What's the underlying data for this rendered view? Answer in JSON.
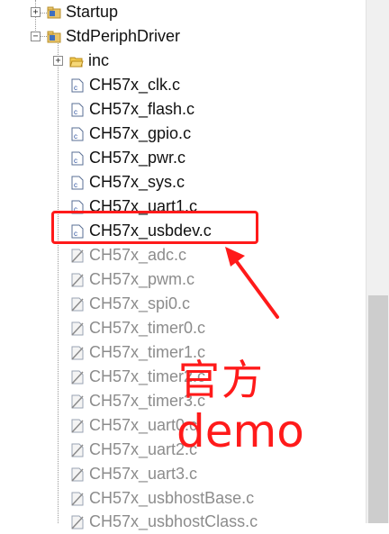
{
  "tree": {
    "folders": [
      {
        "label": "Startup",
        "expander": "+"
      },
      {
        "label": "StdPeriphDriver",
        "expander": "−"
      },
      {
        "label": "inc",
        "expander": "+"
      }
    ],
    "files": [
      {
        "label": "CH57x_clk.c",
        "excluded": false
      },
      {
        "label": "CH57x_flash.c",
        "excluded": false
      },
      {
        "label": "CH57x_gpio.c",
        "excluded": false
      },
      {
        "label": "CH57x_pwr.c",
        "excluded": false
      },
      {
        "label": "CH57x_sys.c",
        "excluded": false
      },
      {
        "label": "CH57x_uart1.c",
        "excluded": false
      },
      {
        "label": "CH57x_usbdev.c",
        "excluded": false
      },
      {
        "label": "CH57x_adc.c",
        "excluded": true
      },
      {
        "label": "CH57x_pwm.c",
        "excluded": true
      },
      {
        "label": "CH57x_spi0.c",
        "excluded": true
      },
      {
        "label": "CH57x_timer0.c",
        "excluded": true
      },
      {
        "label": "CH57x_timer1.c",
        "excluded": true
      },
      {
        "label": "CH57x_timer2.c",
        "excluded": true
      },
      {
        "label": "CH57x_timer3.c",
        "excluded": true
      },
      {
        "label": "CH57x_uart0.c",
        "excluded": true
      },
      {
        "label": "CH57x_uart2.c",
        "excluded": true
      },
      {
        "label": "CH57x_uart3.c",
        "excluded": true
      },
      {
        "label": "CH57x_usbhostBase.c",
        "excluded": true
      },
      {
        "label": "CH57x_usbhostClass.c",
        "excluded": true
      }
    ]
  },
  "annotation": {
    "chinese": "官方",
    "english": "demo",
    "color": "#ff1a1a"
  }
}
